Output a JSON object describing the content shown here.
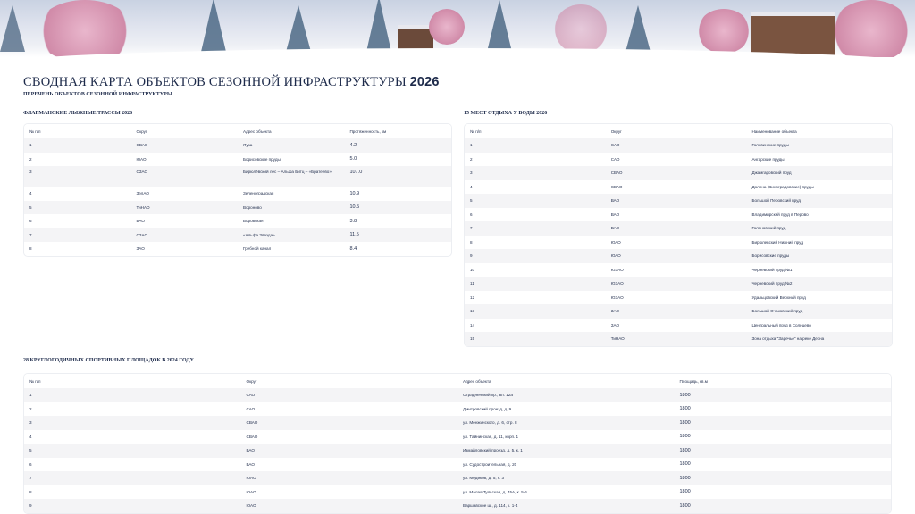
{
  "header": {
    "title": "СВОДНАЯ КАРТА ОБЪЕКТОВ СЕЗОННОЙ ИНФРАСТРУКТУРЫ",
    "title_year": "2026",
    "subtitle": "ПЕРЕЧЕНЬ ОБЪЕКТОВ СЕЗОННОЙ ИНФРАСТРУКТУРЫ"
  },
  "ski": {
    "title": "ФЛАГМАНСКИЕ ЛЫЖНЫЕ ТРАССЫ 2026",
    "columns": [
      "№ п/п",
      "Округ",
      "Адрес объекта",
      "Протяженность, км"
    ],
    "rows": [
      [
        "1",
        "СВАО",
        "Яуза",
        "4.2"
      ],
      [
        "2",
        "ЮАО",
        "Борисовские пруды",
        "5.0"
      ],
      [
        "3",
        "СЗАО",
        "Бирюлёвский лес – Альфа Битц – «Братеево»",
        "107.0"
      ],
      [
        "4",
        "ЗелАО",
        "Зеленоградская",
        "10.9"
      ],
      [
        "5",
        "ТиНАО",
        "Вороново",
        "10.5"
      ],
      [
        "6",
        "ВАО",
        "Боровская",
        "3.8"
      ],
      [
        "7",
        "СЗАО",
        "«Альфа Звезда»",
        "11.5"
      ],
      [
        "8",
        "ЗАО",
        "Гребной канал",
        "8.4"
      ]
    ]
  },
  "water": {
    "title": "15 МЕСТ ОТДЫХА У ВОДЫ 2026",
    "columns": [
      "№ п/п",
      "Округ",
      "Наименование объекта"
    ],
    "rows": [
      [
        "1",
        "САО",
        "Головинские пруды"
      ],
      [
        "2",
        "САО",
        "Ангарские пруды"
      ],
      [
        "3",
        "СВАО",
        "Джамгаровский пруд"
      ],
      [
        "4",
        "СВАО",
        "Долина (Виноградовские) пруды"
      ],
      [
        "5",
        "ВАО",
        "Большой Перовский пруд"
      ],
      [
        "6",
        "ВАО",
        "Владимирский пруд в Перово"
      ],
      [
        "7",
        "ВАО",
        "Голяновский пруд"
      ],
      [
        "8",
        "ЮАО",
        "Бирюлевский Нижний пруд"
      ],
      [
        "9",
        "ЮАО",
        "Борисовские пруды"
      ],
      [
        "10",
        "ЮЗАО",
        "Черневский пруд №1"
      ],
      [
        "11",
        "ЮЗАО",
        "Черневский пруд №2"
      ],
      [
        "12",
        "ЮЗАО",
        "Удальцовский Верхний пруд"
      ],
      [
        "13",
        "ЗАО",
        "Большой Очаковский пруд"
      ],
      [
        "14",
        "ЗАО",
        "Центральный пруд в Солнцево"
      ],
      [
        "15",
        "ТиНАО",
        "Зона отдыха \"Заречье\" на реке Десна"
      ]
    ]
  },
  "sport": {
    "title": "28 КРУГЛОГОДИЧНЫХ СПОРТИВНЫХ ПЛОЩАДОК В 2024 ГОДУ",
    "columns": [
      "№ п/п",
      "Округ",
      "Адрес объекта",
      "Площадь, кв.м"
    ],
    "rows": [
      [
        "1",
        "САО",
        "Отрадненский пр., вл. 12а",
        "1800"
      ],
      [
        "2",
        "САО",
        "Дмитровский проезд, д. 9",
        "1800"
      ],
      [
        "3",
        "СВАО",
        "ул. Менжинского, д. 6, стр. 8",
        "1800"
      ],
      [
        "4",
        "СВАО",
        "ул. Тайнинская, д. 11, корп. 1",
        "1800"
      ],
      [
        "5",
        "ВАО",
        "Измайловский проезд, д. 5, к. 1",
        "1800"
      ],
      [
        "6",
        "ВАО",
        "ул. Судостроительная, д. 20",
        "1800"
      ],
      [
        "7",
        "ЮАО",
        "ул. Медиков, д. 5, к. 3",
        "1800"
      ],
      [
        "8",
        "ЮАО",
        "ул. Малая Тульская, д. 45А, к. 5-6",
        "1800"
      ],
      [
        "9",
        "ЮАО",
        "Варшавское ш., д. 114, к. 1-4",
        "1800"
      ]
    ]
  }
}
